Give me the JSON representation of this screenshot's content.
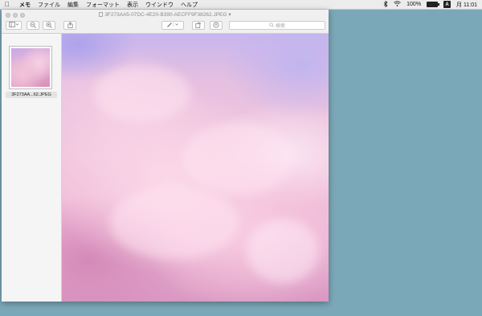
{
  "menubar": {
    "items": [
      "メモ",
      "ファイル",
      "編集",
      "フォーマット",
      "表示",
      "ウインドウ",
      "ヘルプ"
    ],
    "battery_percent": "100%",
    "battery_level": 1.0,
    "input_method": "A",
    "clock": "月 11:01"
  },
  "window": {
    "title": "3F273AA5-07DC-4E20-B390-AECFF9F38262.JPEG",
    "search_placeholder": "検索",
    "thumbnail_label": "3F273AA...62.JPEG"
  },
  "colors": {
    "desktop": "#7ba8b8",
    "menubar": "#ececec",
    "toolbar": "#f0f0f0",
    "sidebar": "#f5f5f5"
  },
  "icons": {
    "menubar": [
      "apple-icon",
      "bluetooth-icon",
      "wifi-icon",
      "battery-icon"
    ],
    "toolbar": [
      "sidebar-toggle-icon",
      "zoom-out-icon",
      "zoom-in-icon",
      "share-icon",
      "markup-pen-icon",
      "rotate-icon",
      "annotate-icon",
      "search-icon"
    ]
  }
}
